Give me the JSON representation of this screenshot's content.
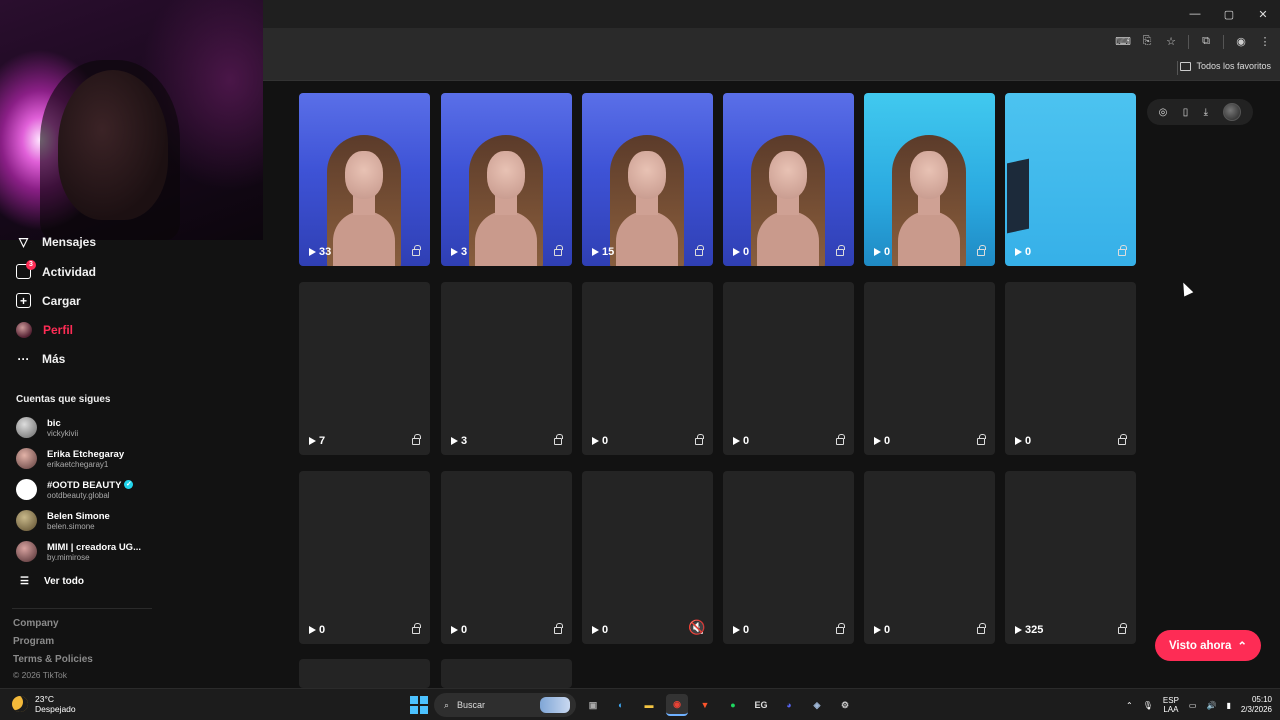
{
  "browser": {
    "window_controls": [
      "—",
      "▢",
      "✕"
    ],
    "bookmarks_folder": "Todos los favoritos"
  },
  "sidebar": {
    "items": [
      {
        "label": "Mensajes",
        "icon": "send-icon"
      },
      {
        "label": "Actividad",
        "icon": "inbox-icon",
        "badge": "3"
      },
      {
        "label": "Cargar",
        "icon": "plus-box-icon"
      },
      {
        "label": "Perfil",
        "icon": "avatar"
      },
      {
        "label": "Más",
        "icon": "more-icon"
      }
    ],
    "following_title": "Cuentas que sigues",
    "following": [
      {
        "name": "bic",
        "handle": "vickykivii"
      },
      {
        "name": "Erika Etchegaray",
        "handle": "erikaetchegaray1"
      },
      {
        "name": "#OOTD BEAUTY",
        "handle": "ootdbeauty.global",
        "verified": true
      },
      {
        "name": "Belen Simone",
        "handle": "belen.simone"
      },
      {
        "name": "MIMI | creadora UG...",
        "handle": "by.mimirose"
      }
    ],
    "see_all": "Ver todo",
    "footer_links": [
      "Company",
      "Program",
      "Terms & Policies"
    ],
    "copyright": "© 2026 TikTok"
  },
  "videos": {
    "row1": [
      "33",
      "3",
      "15",
      "0",
      "0",
      "0"
    ],
    "row2": [
      "7",
      "3",
      "0",
      "0",
      "0",
      "0"
    ],
    "row3": [
      "0",
      "0",
      "0",
      "0",
      "0",
      "325"
    ]
  },
  "visto_button": "Visto ahora",
  "taskbar": {
    "temperature": "23°C",
    "weather": "Despejado",
    "search_placeholder": "Buscar",
    "lang_top": "ESP",
    "lang_bottom": "LAA",
    "time": "05:10",
    "date": "2/3/2026"
  },
  "colors": {
    "accent": "#fe2c55",
    "background": "#121212",
    "card_empty": "#242424"
  }
}
